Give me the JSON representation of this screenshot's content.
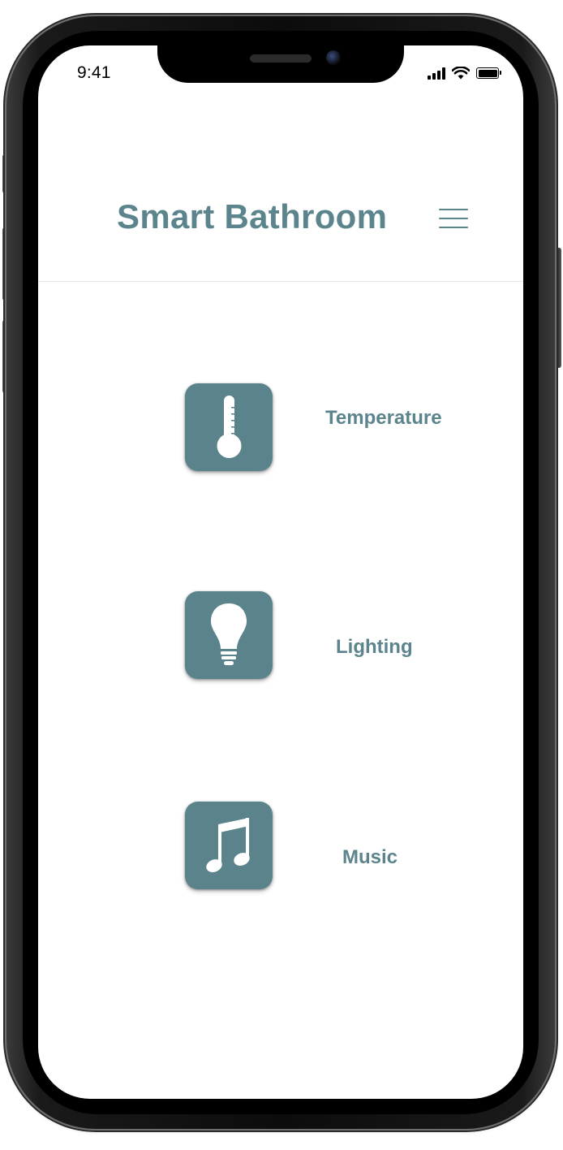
{
  "status_bar": {
    "time": "9:41",
    "icons": [
      "signal-icon",
      "wifi-icon",
      "battery-icon"
    ]
  },
  "header": {
    "title": "Smart Bathroom",
    "menu_icon": "hamburger-menu-icon"
  },
  "features": [
    {
      "label": "Temperature",
      "icon": "thermometer-icon"
    },
    {
      "label": "Lighting",
      "icon": "lightbulb-icon"
    },
    {
      "label": "Music",
      "icon": "music-note-icon"
    }
  ],
  "colors": {
    "accent": "#5c848c",
    "tile": "#5b838b",
    "background": "#ffffff"
  }
}
